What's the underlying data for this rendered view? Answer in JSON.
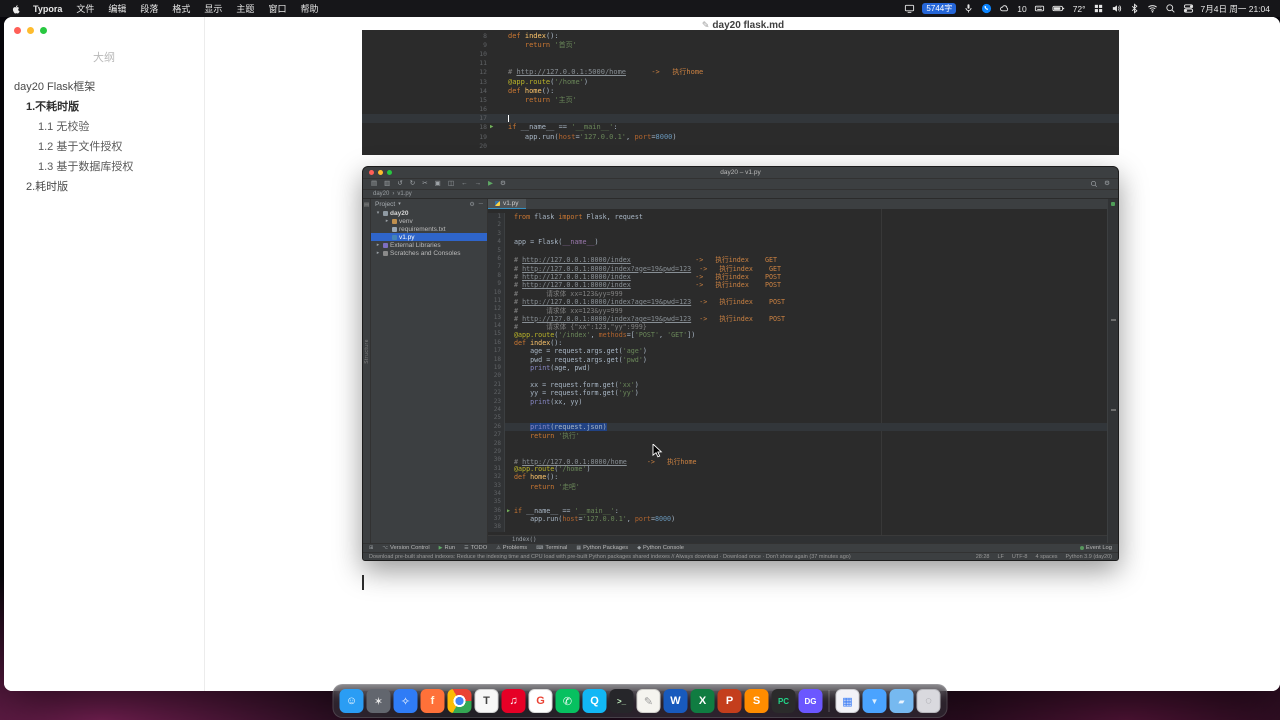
{
  "menubar": {
    "app_name": "Typora",
    "menus": [
      "文件",
      "编辑",
      "段落",
      "格式",
      "显示",
      "主题",
      "窗口",
      "帮助"
    ],
    "status_items": [
      {
        "n": "screen-mirroring-icon",
        "icon": "display"
      },
      {
        "n": "word-count-badge",
        "badge": "5744字"
      },
      {
        "n": "mic-icon",
        "icon": "mic"
      },
      {
        "n": "phone-icon",
        "icon": "phone"
      },
      {
        "n": "cloud-icon",
        "icon": "cloud",
        "text": "10"
      },
      {
        "n": "input-source-icon",
        "icon": "keyboard"
      },
      {
        "n": "battery-icon",
        "icon": "battery"
      },
      {
        "n": "temperature",
        "text": "72°"
      },
      {
        "n": "stage-manager-icon",
        "icon": "grid"
      },
      {
        "n": "volume-icon",
        "icon": "volume"
      },
      {
        "n": "bluetooth-icon",
        "icon": "bluetooth"
      },
      {
        "n": "wifi-icon",
        "icon": "wifi"
      },
      {
        "n": "spotlight-icon",
        "icon": "search"
      },
      {
        "n": "control-center-icon",
        "icon": "cc"
      },
      {
        "n": "datetime",
        "text": "7月4日 周一 21:04"
      }
    ]
  },
  "sidebar": {
    "title": "大纲",
    "items": [
      {
        "label": "day20 Flask框架",
        "level": 0,
        "bold": false
      },
      {
        "label": "1.不耗时版",
        "level": 1,
        "bold": true
      },
      {
        "label": "1.1 无校验",
        "level": 2,
        "bold": false
      },
      {
        "label": "1.2 基于文件授权",
        "level": 2,
        "bold": false
      },
      {
        "label": "1.3 基于数据库授权",
        "level": 2,
        "bold": false
      },
      {
        "label": "2.耗时版",
        "level": 1,
        "bold": false
      }
    ]
  },
  "document": {
    "title": "day20 flask.md",
    "title_icon": "✎"
  },
  "snippet": {
    "lines": [
      {
        "n": 8,
        "segs": [
          [
            "k",
            "def "
          ],
          [
            "f",
            "index"
          ],
          [
            "p",
            "():"
          ]
        ]
      },
      {
        "n": 9,
        "segs": [
          [
            "p",
            "    "
          ],
          [
            "k",
            "return "
          ],
          [
            "s",
            "'首页'"
          ]
        ]
      },
      {
        "n": 10
      },
      {
        "n": 11
      },
      {
        "n": 12,
        "segs": [
          [
            "c",
            "# "
          ],
          [
            "l",
            "http://127.0.0.1:5000/home"
          ],
          [
            "c",
            "      "
          ],
          [
            "o",
            "->   执行home"
          ]
        ]
      },
      {
        "n": 13,
        "segs": [
          [
            "d",
            "@app.route"
          ],
          [
            "p",
            "("
          ],
          [
            "s",
            "'/home'"
          ],
          [
            "p",
            ")"
          ]
        ]
      },
      {
        "n": 14,
        "segs": [
          [
            "k",
            "def "
          ],
          [
            "f",
            "home"
          ],
          [
            "p",
            "():"
          ]
        ]
      },
      {
        "n": 15,
        "segs": [
          [
            "p",
            "    "
          ],
          [
            "k",
            "return "
          ],
          [
            "s",
            "'主页'"
          ]
        ]
      },
      {
        "n": 16
      },
      {
        "n": 17,
        "current": true,
        "caret": true
      },
      {
        "n": 18,
        "arrow": true,
        "segs": [
          [
            "k",
            "if "
          ],
          [
            "p",
            "__name__ == "
          ],
          [
            "s",
            "'__main__'"
          ],
          [
            "p",
            ":"
          ]
        ]
      },
      {
        "n": 19,
        "segs": [
          [
            "p",
            "    app.run("
          ],
          [
            "a",
            "host"
          ],
          [
            "p",
            "="
          ],
          [
            "s",
            "'127.0.0.1'"
          ],
          [
            "p",
            ", "
          ],
          [
            "a",
            "port"
          ],
          [
            "p",
            "="
          ],
          [
            "nu",
            "8000"
          ],
          [
            "p",
            ")"
          ]
        ]
      },
      {
        "n": 20
      }
    ]
  },
  "pycharm": {
    "title": "day20 – v1.py",
    "toolbar_left": [
      {
        "n": "open",
        "g": "▤"
      },
      {
        "n": "save",
        "g": "▥"
      },
      {
        "n": "undo",
        "g": "↺"
      },
      {
        "n": "redo",
        "g": "↻"
      },
      {
        "n": "cut",
        "g": "✂"
      },
      {
        "n": "copy",
        "g": "▣"
      },
      {
        "n": "paste",
        "g": "◫"
      },
      {
        "n": "back",
        "g": "←"
      },
      {
        "n": "forward",
        "g": "→"
      },
      {
        "n": "run",
        "g": "▶",
        "c": "#5fa865"
      },
      {
        "n": "settings",
        "g": "⚙"
      }
    ],
    "breadcrumb": [
      "day20",
      "v1.py"
    ],
    "project": {
      "header": "Project",
      "header_icons": [
        {
          "n": "settings",
          "g": "⚙"
        },
        {
          "n": "hide",
          "g": "─"
        }
      ],
      "tree": [
        {
          "label": "day20",
          "level": 0,
          "arrow": "▾",
          "icon": "folder",
          "bold": true
        },
        {
          "label": "venv",
          "level": 1,
          "arrow": "▸",
          "icon": "folder-v"
        },
        {
          "label": "requirements.txt",
          "level": 1,
          "icon": "file"
        },
        {
          "label": "v1.py",
          "level": 1,
          "icon": "py",
          "selected": true
        },
        {
          "label": "External Libraries",
          "level": 0,
          "arrow": "▸",
          "icon": "lib"
        },
        {
          "label": "Scratches and Consoles",
          "level": 0,
          "arrow": "▸",
          "icon": "scratch"
        }
      ]
    },
    "tab": "v1.py",
    "stripe_left_label": "Structure",
    "lines": [
      {
        "n": 1,
        "segs": [
          [
            "k",
            "from "
          ],
          [
            "p",
            "flask "
          ],
          [
            "k",
            "import "
          ],
          [
            "p",
            "Flask, request"
          ]
        ]
      },
      {
        "n": 2
      },
      {
        "n": 3
      },
      {
        "n": 4,
        "segs": [
          [
            "p",
            "app = Flask("
          ],
          [
            "m",
            "__name__"
          ],
          [
            "p",
            ")"
          ]
        ]
      },
      {
        "n": 5
      },
      {
        "n": 6,
        "segs": [
          [
            "c",
            "# "
          ],
          [
            "l",
            "http://127.0.0.1:8000/index"
          ],
          [
            "c",
            "                "
          ],
          [
            "o",
            "->   执行index    GET"
          ]
        ]
      },
      {
        "n": 7,
        "segs": [
          [
            "c",
            "# "
          ],
          [
            "l",
            "http://127.0.0.1:8000/index?age=19&pwd=123"
          ],
          [
            "c",
            "  "
          ],
          [
            "o",
            "->   执行index    GET"
          ]
        ]
      },
      {
        "n": 8,
        "segs": [
          [
            "c",
            "# "
          ],
          [
            "l",
            "http://127.0.0.1:8000/index"
          ],
          [
            "c",
            "                "
          ],
          [
            "o",
            "->   执行index    POST"
          ]
        ]
      },
      {
        "n": 9,
        "segs": [
          [
            "c",
            "# "
          ],
          [
            "l",
            "http://127.0.0.1:8000/index"
          ],
          [
            "c",
            "                "
          ],
          [
            "o",
            "->   执行index    POST"
          ]
        ]
      },
      {
        "n": 10,
        "segs": [
          [
            "c",
            "#       请求体 xx=123&yy=999"
          ]
        ]
      },
      {
        "n": 11,
        "segs": [
          [
            "c",
            "# "
          ],
          [
            "l",
            "http://127.0.0.1:8000/index?age=19&pwd=123"
          ],
          [
            "c",
            "  "
          ],
          [
            "o",
            "->   执行index    POST"
          ]
        ]
      },
      {
        "n": 12,
        "segs": [
          [
            "c",
            "#       请求体 xx=123&yy=999"
          ]
        ]
      },
      {
        "n": 13,
        "segs": [
          [
            "c",
            "# "
          ],
          [
            "l",
            "http://127.0.0.1:8000/index?age=19&pwd=123"
          ],
          [
            "c",
            "  "
          ],
          [
            "o",
            "->   执行index    POST"
          ]
        ]
      },
      {
        "n": 14,
        "segs": [
          [
            "c",
            "#       请求体 {\"xx\":123,\"yy\":999}"
          ]
        ]
      },
      {
        "n": 15,
        "segs": [
          [
            "d",
            "@app.route"
          ],
          [
            "p",
            "("
          ],
          [
            "s",
            "'/index'"
          ],
          [
            "p",
            ", "
          ],
          [
            "a",
            "methods"
          ],
          [
            "p",
            "=["
          ],
          [
            "s",
            "'POST'"
          ],
          [
            "p",
            ", "
          ],
          [
            "s",
            "'GET'"
          ],
          [
            "p",
            "])"
          ]
        ]
      },
      {
        "n": 16,
        "segs": [
          [
            "k",
            "def "
          ],
          [
            "f",
            "index"
          ],
          [
            "p",
            "():"
          ]
        ]
      },
      {
        "n": 17,
        "segs": [
          [
            "p",
            "    age = request.args.get("
          ],
          [
            "s",
            "'age'"
          ],
          [
            "p",
            ")"
          ]
        ]
      },
      {
        "n": 18,
        "segs": [
          [
            "p",
            "    pwd = request.args.get("
          ],
          [
            "s",
            "'pwd'"
          ],
          [
            "p",
            ")"
          ]
        ]
      },
      {
        "n": 19,
        "segs": [
          [
            "p",
            "    "
          ],
          [
            "b",
            "print"
          ],
          [
            "p",
            "(age, pwd)"
          ]
        ]
      },
      {
        "n": 20
      },
      {
        "n": 21,
        "segs": [
          [
            "p",
            "    xx = request.form.get("
          ],
          [
            "s",
            "'xx'"
          ],
          [
            "p",
            ")"
          ]
        ]
      },
      {
        "n": 22,
        "segs": [
          [
            "p",
            "    yy = request.form.get("
          ],
          [
            "s",
            "'yy'"
          ],
          [
            "p",
            ")"
          ]
        ]
      },
      {
        "n": 23,
        "segs": [
          [
            "p",
            "    "
          ],
          [
            "b",
            "print"
          ],
          [
            "p",
            "(xx, yy)"
          ]
        ]
      },
      {
        "n": 24
      },
      {
        "n": 25
      },
      {
        "n": 26,
        "current": true,
        "segs": [
          [
            "p",
            "    "
          ],
          [
            "b",
            "print",
            1
          ],
          [
            "p",
            "(request.json)",
            1
          ]
        ]
      },
      {
        "n": 27,
        "segs": [
          [
            "p",
            "    "
          ],
          [
            "k",
            "return "
          ],
          [
            "s",
            "'执行'"
          ]
        ]
      },
      {
        "n": 28
      },
      {
        "n": 29
      },
      {
        "n": 30,
        "segs": [
          [
            "c",
            "# "
          ],
          [
            "l",
            "http://127.0.0.1:8000/home"
          ],
          [
            "c",
            "     "
          ],
          [
            "o",
            "->   执行home"
          ]
        ]
      },
      {
        "n": 31,
        "segs": [
          [
            "d",
            "@app.route"
          ],
          [
            "p",
            "("
          ],
          [
            "s",
            "'/home'"
          ],
          [
            "p",
            ")"
          ]
        ]
      },
      {
        "n": 32,
        "segs": [
          [
            "k",
            "def "
          ],
          [
            "f",
            "home"
          ],
          [
            "p",
            "():"
          ]
        ]
      },
      {
        "n": 33,
        "segs": [
          [
            "p",
            "    "
          ],
          [
            "k",
            "return "
          ],
          [
            "s",
            "'走吧'"
          ]
        ]
      },
      {
        "n": 34
      },
      {
        "n": 35
      },
      {
        "n": 36,
        "arrow": true,
        "segs": [
          [
            "k",
            "if "
          ],
          [
            "p",
            "__name__ == "
          ],
          [
            "s",
            "'__main__'"
          ],
          [
            "p",
            ":"
          ]
        ]
      },
      {
        "n": 37,
        "segs": [
          [
            "p",
            "    app.run("
          ],
          [
            "a",
            "host"
          ],
          [
            "p",
            "="
          ],
          [
            "s",
            "'127.0.0.1'"
          ],
          [
            "p",
            ", "
          ],
          [
            "a",
            "port"
          ],
          [
            "p",
            "="
          ],
          [
            "nu",
            "8000"
          ],
          [
            "p",
            ")"
          ]
        ]
      },
      {
        "n": 38
      }
    ],
    "sticky": "index()",
    "bottom_left": [
      {
        "n": "toolwindow-toggle",
        "g": "⊞",
        "t": ""
      },
      {
        "n": "version-control",
        "g": "⌥",
        "t": "Version Control"
      },
      {
        "n": "run",
        "g": "▶",
        "t": "Run",
        "c": "#5fa865"
      },
      {
        "n": "todo",
        "g": "☰",
        "t": "TODO"
      },
      {
        "n": "problems",
        "g": "⚠",
        "t": "Problems"
      },
      {
        "n": "terminal",
        "g": "⌨",
        "t": "Terminal"
      },
      {
        "n": "python-packages",
        "g": "▦",
        "t": "Python Packages"
      },
      {
        "n": "python-console",
        "g": "◆",
        "t": "Python Console"
      }
    ],
    "event_log": {
      "t": "Event Log"
    },
    "status": {
      "message": "Download pre-built shared indexes: Reduce the indexing time and CPU load with pre-built Python packages shared indexes // Always download · Download once · Don't show again (37 minutes ago)",
      "items": [
        "28:28",
        "LF",
        "UTF-8",
        "4 spaces",
        "Python 3.9 (day20)"
      ]
    }
  },
  "dock": {
    "items": [
      {
        "n": "finder",
        "bg": "#2a9df4",
        "fg": "#ffffff",
        "g": "☺"
      },
      {
        "n": "launchpad",
        "bg": "#62666e",
        "fg": "#e8e8e8",
        "g": "✶"
      },
      {
        "n": "safari",
        "bg": "#2f7cf6",
        "fg": "#ffffff",
        "g": "✧"
      },
      {
        "n": "firefox",
        "bg": "#ff7139",
        "fg": "#fff7e0",
        "g": "f"
      },
      {
        "n": "chrome",
        "chrome": true,
        "g": ""
      },
      {
        "n": "typora",
        "bg": "#f7f7f7",
        "fg": "#444444",
        "g": "T",
        "border": true
      },
      {
        "n": "netease-music",
        "bg": "#e60026",
        "fg": "#ffffff",
        "g": "♫"
      },
      {
        "n": "google",
        "bg": "#ffffff",
        "fg": "#ea4335",
        "g": "G",
        "border": true
      },
      {
        "n": "wechat",
        "bg": "#07c160",
        "fg": "#ffffff",
        "g": "✆"
      },
      {
        "n": "qq",
        "bg": "#12b7f5",
        "fg": "#ffffff",
        "g": "Q"
      },
      {
        "n": "terminal",
        "bg": "#26262a",
        "fg": "#c8f7c5",
        "g": ">_",
        "small": true
      },
      {
        "n": "notes",
        "bg": "#f5f4ef",
        "fg": "#999999",
        "g": "✎",
        "border": true
      },
      {
        "n": "word",
        "bg": "#185abd",
        "fg": "#ffffff",
        "g": "W"
      },
      {
        "n": "excel",
        "bg": "#107c41",
        "fg": "#ffffff",
        "g": "X"
      },
      {
        "n": "powerpoint",
        "bg": "#c43e1c",
        "fg": "#ffffff",
        "g": "P"
      },
      {
        "n": "sublime-text",
        "bg": "#ff8c00",
        "fg": "#ffffff",
        "g": "S"
      },
      {
        "n": "pycharm",
        "bg": "#2b2b2b",
        "fg": "#21d789",
        "g": "PC",
        "small": true
      },
      {
        "n": "datagrip",
        "bg": "#6b57ff",
        "fg": "#ffffff",
        "g": "DG",
        "small": true
      },
      {
        "n": "preview",
        "bg": "#f2f2f7",
        "fg": "#3478f6",
        "g": "▦",
        "border": true,
        "divider": true
      },
      {
        "n": "downloads-folder",
        "bg": "#4aa3ff",
        "fg": "#dbeeff",
        "g": "▼",
        "small": true
      },
      {
        "n": "documents-folder",
        "bg": "#76b9f0",
        "fg": "#eaf4ff",
        "g": "▰",
        "small": true
      },
      {
        "n": "trash",
        "bg": "#d9d9de",
        "fg": "#8a8a90",
        "g": "◌",
        "border": true
      }
    ]
  }
}
